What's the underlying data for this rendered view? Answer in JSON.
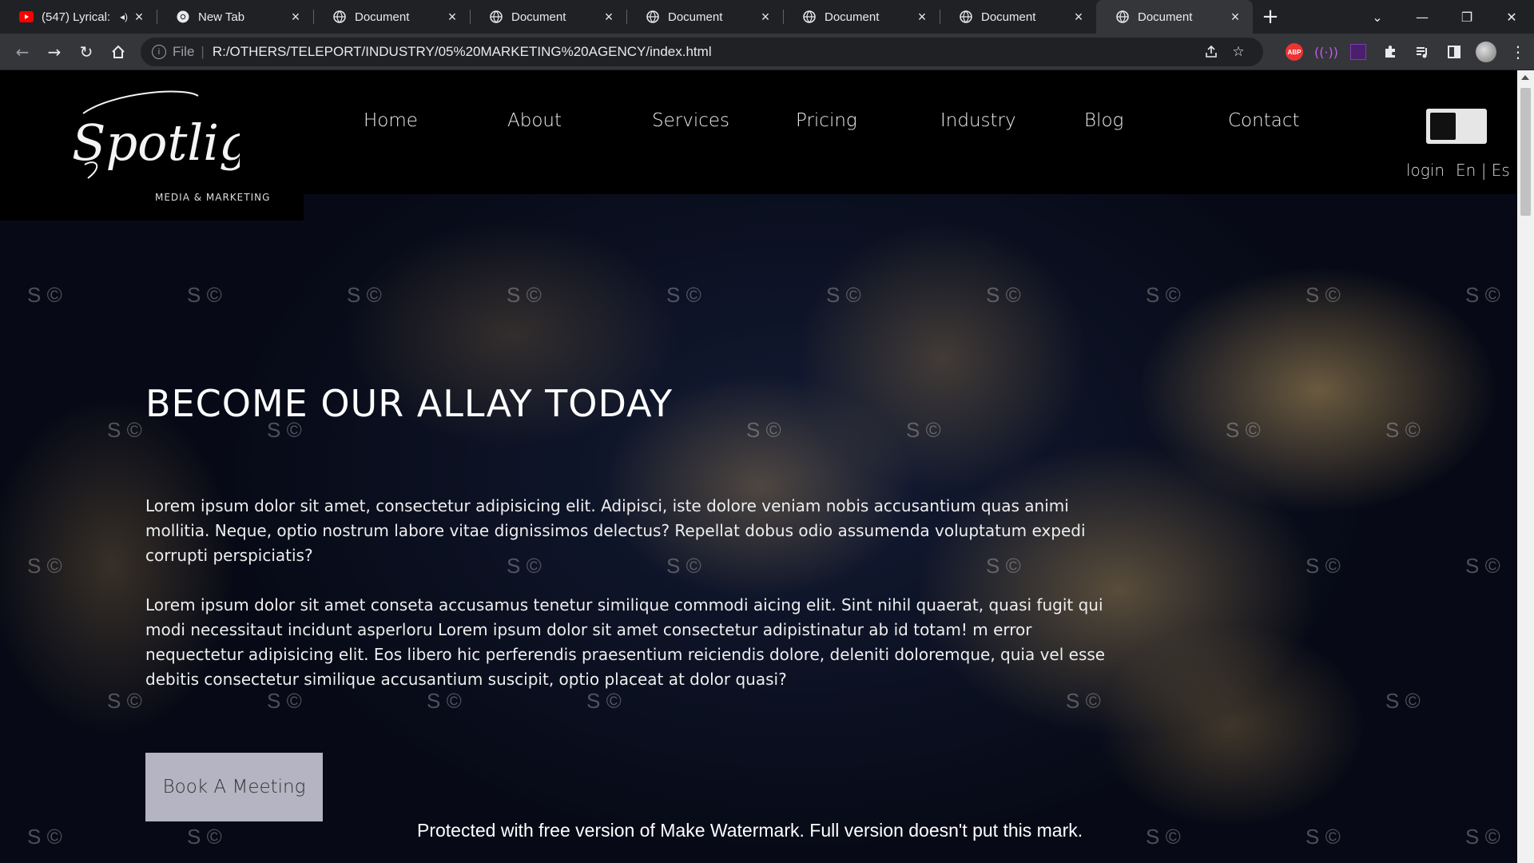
{
  "browser": {
    "tabs": [
      {
        "title": "(547) Lyrical:",
        "favicon": "youtube-icon",
        "audio": true,
        "active": false
      },
      {
        "title": "New Tab",
        "favicon": "chrome-icon",
        "audio": false,
        "active": false
      },
      {
        "title": "Document",
        "favicon": "globe-icon",
        "audio": false,
        "active": false
      },
      {
        "title": "Document",
        "favicon": "globe-icon",
        "audio": false,
        "active": false
      },
      {
        "title": "Document",
        "favicon": "globe-icon",
        "audio": false,
        "active": false
      },
      {
        "title": "Document",
        "favicon": "globe-icon",
        "audio": false,
        "active": false
      },
      {
        "title": "Document",
        "favicon": "globe-icon",
        "audio": false,
        "active": false
      },
      {
        "title": "Document",
        "favicon": "globe-icon",
        "audio": false,
        "active": true
      }
    ],
    "omnibox": {
      "scheme": "File",
      "separator": "|",
      "url": "R:/OTHERS/TELEPORT/INDUSTRY/05%20MARKETING%20AGENCY/index.html"
    },
    "extensions": {
      "abp_label": "ABP",
      "wave_label": "((·))"
    }
  },
  "site": {
    "logo": {
      "script_text": "Spotlight",
      "tagline": "MEDIA & MARKETING"
    },
    "nav": [
      {
        "label": "Home"
      },
      {
        "label": "About"
      },
      {
        "label": "Services"
      },
      {
        "label": "Pricing"
      },
      {
        "label": "Industry"
      },
      {
        "label": "Blog"
      },
      {
        "label": "Contact"
      }
    ],
    "util": {
      "login": "login",
      "languages": "En | Es"
    },
    "hero": {
      "title": "BECOME OUR ALLAY TODAY",
      "paragraph1": "Lorem ipsum dolor sit amet, consectetur adipisicing elit. Adipisci, iste dolore veniam nobis accusantium quas animi mollitia. Neque, optio nostrum labore vitae dignissimos delectus? Repellat dobus odio assumenda voluptatum expedi corrupti perspiciatis?",
      "paragraph2": "Lorem ipsum dolor sit amet conseta accusamus tenetur similique commodi aicing elit. Sint nihil quaerat, quasi fugit qui modi necessitaut incidunt asperloru Lorem ipsum dolor sit amet consectetur adipistinatur ab id totam! m error nequectetur adipisicing elit. Eos libero hic perferendis praesentium reiciendis dolore, deleniti doloremque, quia vel esse debitis consectetur similique accusantium suscipit, optio placeat at dolor quasi?",
      "cta_label": "Book A Meeting"
    },
    "watermark": {
      "stamp": "S ©",
      "notice": "Protected with free version of Make Watermark. Full version doesn't put this mark."
    }
  },
  "colors": {
    "header_bg": "#000000",
    "cta_bg": "#b4b4c2",
    "night_map_base": "#0b1022",
    "city_lights": "#e1b96e"
  }
}
